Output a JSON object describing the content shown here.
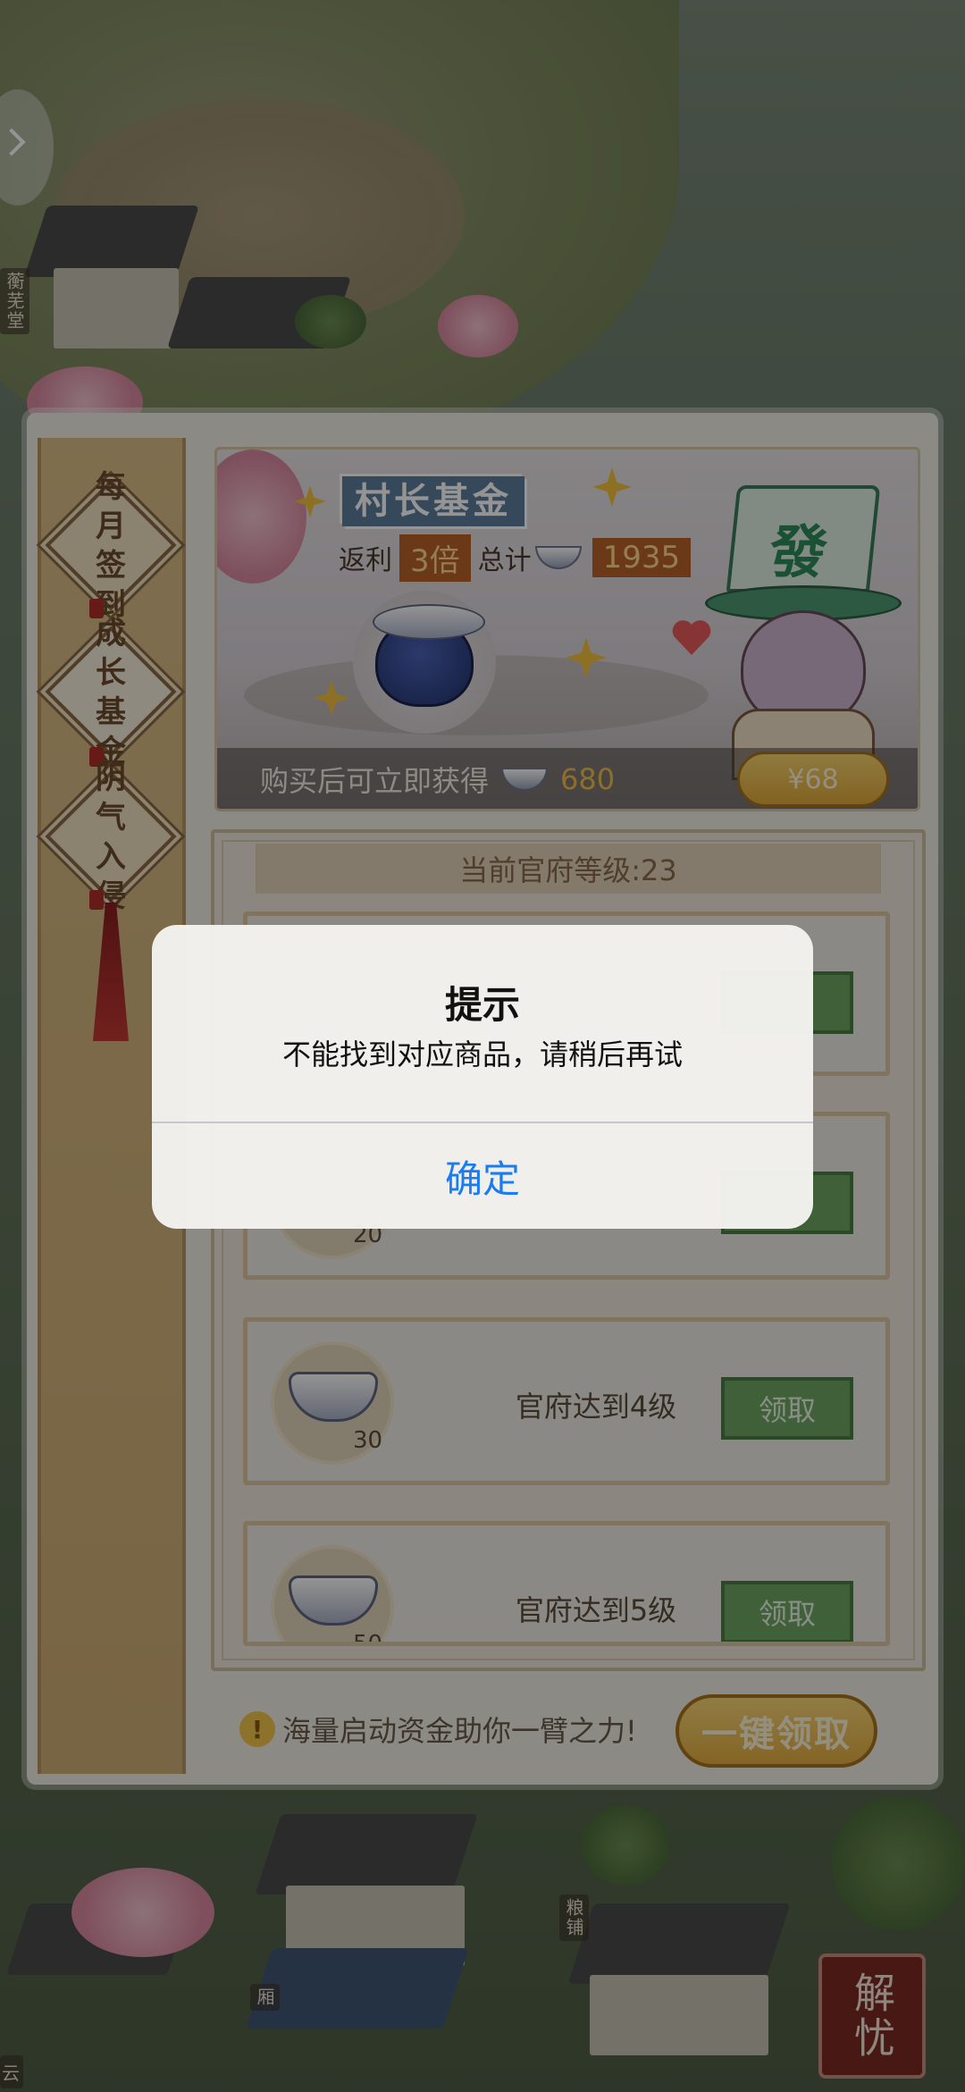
{
  "sidebar": {
    "tabs": [
      {
        "label": "每月签到"
      },
      {
        "label": "成长基金"
      },
      {
        "label": "阴气入侵"
      }
    ]
  },
  "banner": {
    "title": "村长基金",
    "rebate_prefix": "返利",
    "rebate_multiplier": "3倍",
    "total_label": "总计",
    "total_value": "1935",
    "buy_text": "购买后可立即获得",
    "buy_amount": "680",
    "price": "¥68",
    "mascot_hat_char": "發"
  },
  "list": {
    "level_text": "当前官府等级:23",
    "tasks": [
      {
        "amount": "",
        "label": "",
        "button": ""
      },
      {
        "amount": "20",
        "label": "",
        "button": ""
      },
      {
        "amount": "30",
        "label": "官府达到4级",
        "button": "领取"
      },
      {
        "amount": "50",
        "label": "官府达到5级",
        "button": "领取"
      }
    ]
  },
  "footer": {
    "tip": "海量启动资金助你一臂之力!",
    "claim_all": "一键领取"
  },
  "scene": {
    "side_labels": [
      "蘅芜堂",
      "粮铺",
      "厢"
    ],
    "corner_button": "解忧",
    "bottom_left_label": "云"
  },
  "alert": {
    "title": "提示",
    "message": "不能找到对应商品，请稍后再试",
    "ok": "确定"
  },
  "colors": {
    "accent_blue": "#1a7cf0",
    "claim_green": "#6fa664",
    "gold": "#e4ad41"
  }
}
